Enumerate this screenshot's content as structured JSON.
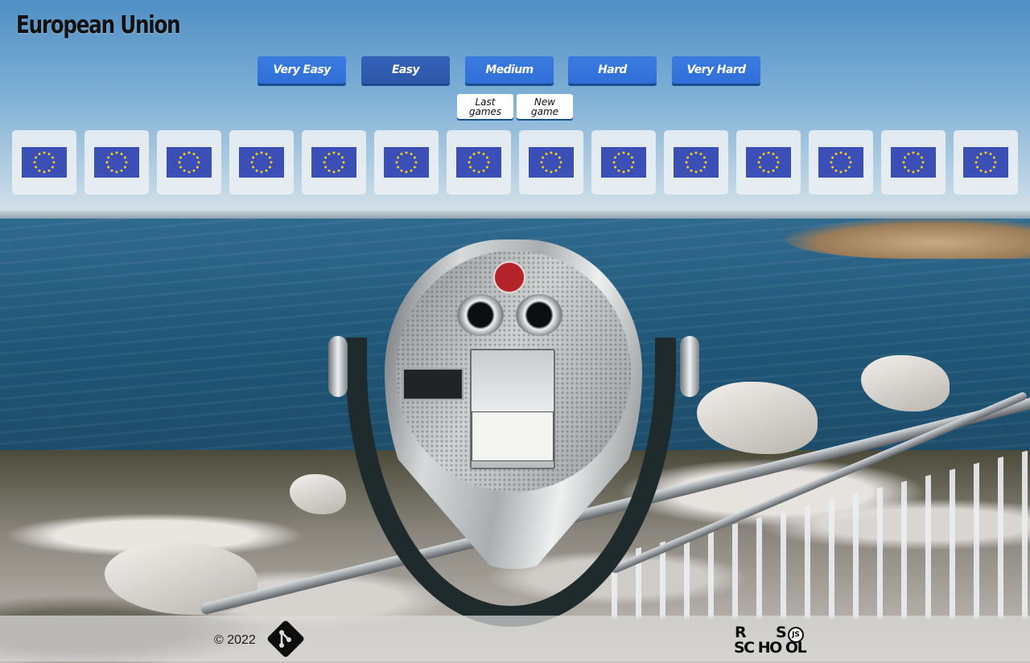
{
  "page": {
    "title": "European Union"
  },
  "levels": [
    {
      "label": "Very Easy",
      "active": false
    },
    {
      "label": "Easy",
      "active": true
    },
    {
      "label": "Medium",
      "active": false
    },
    {
      "label": "Hard",
      "active": false
    },
    {
      "label": "Very Hard",
      "active": false
    }
  ],
  "actions": {
    "last_games": [
      "Last",
      "games"
    ],
    "new_game": [
      "New",
      "game"
    ]
  },
  "cards": {
    "count": 14,
    "flag_name": "eu-flag-icon",
    "flag_colors": {
      "field": "#3b4fb6",
      "stars": "#f5d21a"
    }
  },
  "footer": {
    "copyright": "©  2022",
    "github_icon": "github-icon",
    "school_logo": {
      "r": "R",
      "s": "S",
      "js": "JS",
      "school": "SC HO OL"
    }
  },
  "colors": {
    "button_blue": "#2f6fd8",
    "button_active": "#2d57a8",
    "card_bg": "#ecf0f4"
  }
}
